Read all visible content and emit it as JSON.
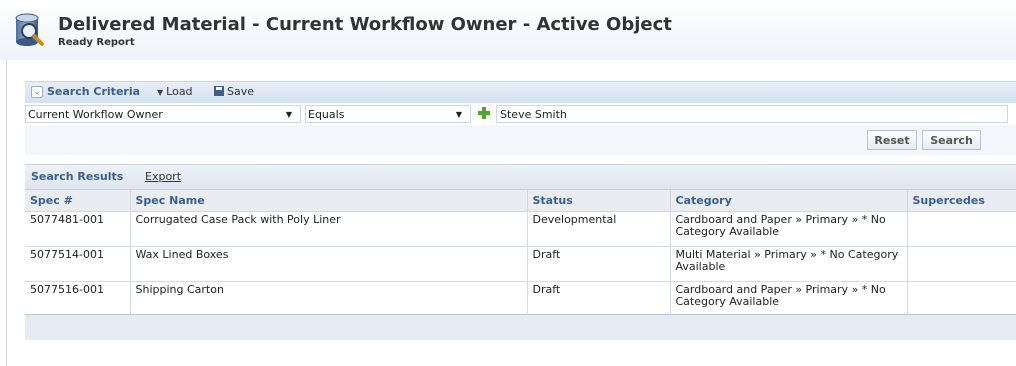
{
  "header": {
    "title": "Delivered Material - Current Workflow Owner - Active Object",
    "subtitle": "Ready Report",
    "icon": "report-magnifier-icon"
  },
  "search_criteria": {
    "title": "Search Criteria",
    "load_label": "Load",
    "save_label": "Save",
    "field_value": "Current Workflow Owner",
    "operator_value": "Equals",
    "search_value": "Steve Smith",
    "reset_label": "Reset",
    "search_label": "Search"
  },
  "results": {
    "title": "Search Results",
    "export_label": "Export",
    "columns": [
      "Spec #",
      "Spec Name",
      "Status",
      "Category",
      "Supercedes"
    ],
    "rows": [
      [
        "5077481-001",
        "Corrugated Case Pack with Poly Liner",
        "Developmental",
        "Cardboard and Paper » Primary » * No Category Available",
        ""
      ],
      [
        "5077514-001",
        "Wax Lined Boxes",
        "Draft",
        "Multi Material » Primary » * No Category Available",
        ""
      ],
      [
        "5077516-001",
        "Shipping Carton",
        "Draft",
        "Cardboard and Paper » Primary » * No Category Available",
        ""
      ]
    ]
  },
  "colors": {
    "accent": "#3a5f8c",
    "header_bg": "#eef3f9",
    "add_green": "#55a330"
  }
}
